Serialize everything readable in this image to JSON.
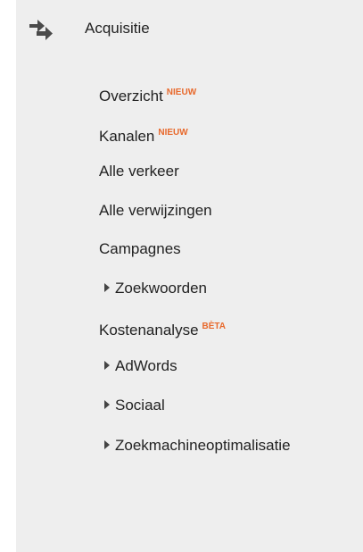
{
  "section": {
    "title": "Acquisitie",
    "icon": "acquisition-arrows-icon"
  },
  "colors": {
    "panel_background": "#eeeeee",
    "text": "#222222",
    "badge": "#e8692c"
  },
  "items": [
    {
      "label": "Overzicht",
      "badge": "NIEUW",
      "expandable": false
    },
    {
      "label": "Kanalen",
      "badge": "NIEUW",
      "expandable": false
    },
    {
      "label": "Alle verkeer",
      "expandable": false
    },
    {
      "label": "Alle verwijzingen",
      "expandable": false
    },
    {
      "label": "Campagnes",
      "expandable": false
    },
    {
      "label": "Zoekwoorden",
      "expandable": true
    },
    {
      "label": "Kostenanalyse",
      "badge": "BÈTA",
      "expandable": false
    },
    {
      "label": "AdWords",
      "expandable": true
    },
    {
      "label": "Sociaal",
      "expandable": true
    },
    {
      "label": "Zoekmachineoptimalisatie",
      "expandable": true
    }
  ]
}
